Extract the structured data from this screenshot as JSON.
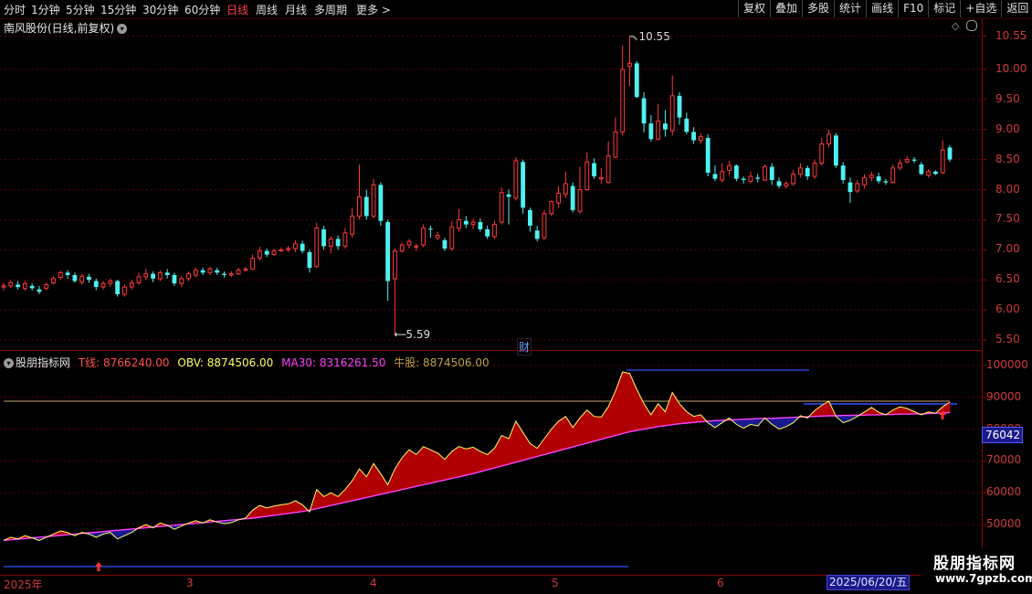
{
  "toolbar": {
    "periods": [
      "分时",
      "1分钟",
      "5分钟",
      "15分钟",
      "30分钟",
      "60分钟",
      "日线",
      "周线",
      "月线",
      "多周期",
      "更多 >"
    ],
    "active_period": "日线",
    "actions": [
      "复权",
      "叠加",
      "多股",
      "统计",
      "画线",
      "F10",
      "标记",
      "+自选",
      "返回"
    ]
  },
  "chart_title": "南风股份(日线,前复权)",
  "price_axis": [
    "10.55",
    "10.00",
    "9.50",
    "9.00",
    "8.50",
    "8.00",
    "7.50",
    "7.00",
    "6.50",
    "6.00",
    "5.50"
  ],
  "annotations": {
    "high": "10.55",
    "low": "5.59",
    "finance_marker": "财"
  },
  "indicator": {
    "name": "股朋指标网",
    "t_line": "T线: 8766240.00",
    "obv": "OBV: 8874506.00",
    "ma30": "MA30: 8316261.50",
    "niu": "牛股: 8874506.00",
    "axis": [
      "100000",
      "90000",
      "80000",
      "70000",
      "60000",
      "50000"
    ],
    "current_value": "76042"
  },
  "dates": {
    "labels": [
      "2025年",
      "3",
      "4",
      "5",
      "6"
    ],
    "selected": "2025/06/20/五"
  },
  "watermark": {
    "title": "股朋指标网",
    "url": "www.7gpzb.com"
  },
  "colors": {
    "up": "#ff3a3a",
    "down": "#4ff0f0",
    "obv_fill": "#b00000",
    "obv_line": "#ffff60",
    "ma30": "#ff40ff",
    "hline": "#3050ff"
  },
  "chart_data": {
    "type": "candlestick",
    "title": "南风股份(日线,前复权)",
    "ylim": [
      5.45,
      10.7
    ],
    "candles": [
      [
        6.38,
        6.4,
        6.45,
        6.32
      ],
      [
        6.4,
        6.45,
        6.5,
        6.36
      ],
      [
        6.42,
        6.38,
        6.48,
        6.34
      ],
      [
        6.36,
        6.44,
        6.48,
        6.32
      ],
      [
        6.4,
        6.36,
        6.44,
        6.32
      ],
      [
        6.34,
        6.3,
        6.4,
        6.26
      ],
      [
        6.36,
        6.42,
        6.46,
        6.32
      ],
      [
        6.45,
        6.52,
        6.56,
        6.42
      ],
      [
        6.54,
        6.62,
        6.65,
        6.5
      ],
      [
        6.62,
        6.58,
        6.66,
        6.52
      ],
      [
        6.58,
        6.48,
        6.62,
        6.45
      ],
      [
        6.46,
        6.56,
        6.6,
        6.42
      ],
      [
        6.55,
        6.5,
        6.6,
        6.45
      ],
      [
        6.48,
        6.38,
        6.52,
        6.33
      ],
      [
        6.38,
        6.44,
        6.48,
        6.34
      ],
      [
        6.44,
        6.48,
        6.52,
        6.38
      ],
      [
        6.48,
        6.26,
        6.5,
        6.22
      ],
      [
        6.26,
        6.38,
        6.42,
        6.22
      ],
      [
        6.38,
        6.45,
        6.5,
        6.34
      ],
      [
        6.45,
        6.55,
        6.62,
        6.42
      ],
      [
        6.55,
        6.6,
        6.68,
        6.5
      ],
      [
        6.6,
        6.52,
        6.64,
        6.46
      ],
      [
        6.52,
        6.62,
        6.66,
        6.48
      ],
      [
        6.62,
        6.58,
        6.68,
        6.52
      ],
      [
        6.58,
        6.44,
        6.62,
        6.4
      ],
      [
        6.44,
        6.52,
        6.56,
        6.38
      ],
      [
        6.52,
        6.6,
        6.64,
        6.48
      ],
      [
        6.58,
        6.66,
        6.7,
        6.54
      ],
      [
        6.66,
        6.62,
        6.7,
        6.58
      ],
      [
        6.62,
        6.68,
        6.72,
        6.58
      ],
      [
        6.66,
        6.62,
        6.7,
        6.58
      ],
      [
        6.6,
        6.58,
        6.64,
        6.54
      ],
      [
        6.58,
        6.6,
        6.64,
        6.55
      ],
      [
        6.6,
        6.66,
        6.7,
        6.58
      ],
      [
        6.66,
        6.68,
        6.72,
        6.64
      ],
      [
        6.68,
        6.86,
        6.92,
        6.66
      ],
      [
        6.86,
        6.98,
        7.05,
        6.82
      ],
      [
        6.98,
        6.92,
        7.02,
        6.88
      ],
      [
        6.92,
        6.98,
        7.02,
        6.9
      ],
      [
        6.98,
        7.0,
        7.04,
        6.96
      ],
      [
        7.0,
        7.02,
        7.06,
        6.96
      ],
      [
        7.02,
        7.1,
        7.16,
        6.96
      ],
      [
        7.1,
        6.98,
        7.15,
        6.94
      ],
      [
        6.96,
        6.7,
        7.0,
        6.62
      ],
      [
        6.72,
        7.36,
        7.45,
        6.7
      ],
      [
        7.34,
        7.06,
        7.4,
        7.0
      ],
      [
        7.06,
        7.18,
        7.22,
        6.94
      ],
      [
        7.18,
        7.06,
        7.24,
        7.0
      ],
      [
        7.06,
        7.28,
        7.36,
        7.02
      ],
      [
        7.26,
        7.56,
        7.7,
        7.2
      ],
      [
        7.56,
        7.88,
        8.42,
        7.5
      ],
      [
        7.88,
        7.56,
        8.0,
        7.5
      ],
      [
        7.56,
        8.08,
        8.18,
        7.52
      ],
      [
        8.08,
        7.48,
        8.12,
        7.4
      ],
      [
        7.46,
        6.48,
        7.5,
        6.15
      ],
      [
        6.52,
        6.98,
        7.02,
        5.59
      ],
      [
        6.98,
        7.08,
        7.12,
        6.95
      ],
      [
        7.08,
        7.14,
        7.18,
        7.02
      ],
      [
        7.05,
        7.06,
        7.1,
        6.98
      ],
      [
        7.08,
        7.36,
        7.42,
        7.04
      ],
      [
        7.35,
        7.34,
        7.4,
        7.2
      ],
      [
        7.2,
        7.24,
        7.3,
        7.16
      ],
      [
        7.16,
        7.02,
        7.2,
        6.98
      ],
      [
        7.02,
        7.38,
        7.48,
        6.98
      ],
      [
        7.36,
        7.5,
        7.68,
        7.3
      ],
      [
        7.48,
        7.42,
        7.56,
        7.36
      ],
      [
        7.42,
        7.46,
        7.52,
        7.34
      ],
      [
        7.46,
        7.34,
        7.52,
        7.3
      ],
      [
        7.34,
        7.22,
        7.4,
        7.18
      ],
      [
        7.22,
        7.42,
        7.48,
        7.18
      ],
      [
        7.46,
        7.95,
        8.04,
        7.42
      ],
      [
        7.92,
        7.88,
        8.0,
        7.42
      ],
      [
        7.86,
        8.48,
        8.54,
        7.82
      ],
      [
        8.46,
        7.7,
        8.5,
        7.6
      ],
      [
        7.66,
        7.4,
        7.7,
        7.3
      ],
      [
        7.32,
        7.18,
        7.4,
        7.14
      ],
      [
        7.2,
        7.6,
        7.66,
        7.16
      ],
      [
        7.6,
        7.8,
        7.82,
        7.56
      ],
      [
        7.78,
        7.94,
        8.06,
        7.7
      ],
      [
        7.92,
        8.1,
        8.3,
        7.86
      ],
      [
        8.06,
        7.66,
        8.12,
        7.62
      ],
      [
        7.64,
        8.0,
        8.38,
        7.6
      ],
      [
        8.0,
        8.46,
        8.62,
        7.98
      ],
      [
        8.44,
        8.22,
        8.52,
        8.18
      ],
      [
        8.18,
        8.2,
        8.36,
        8.1
      ],
      [
        8.12,
        8.56,
        8.8,
        8.1
      ],
      [
        8.54,
        8.96,
        9.2,
        8.52
      ],
      [
        8.96,
        10.0,
        10.4,
        8.9
      ],
      [
        10.05,
        10.1,
        10.55,
        9.72
      ],
      [
        10.1,
        9.54,
        10.14,
        9.52
      ],
      [
        9.52,
        9.1,
        9.62,
        8.95
      ],
      [
        9.1,
        8.84,
        9.24,
        8.8
      ],
      [
        8.84,
        9.14,
        9.42,
        8.82
      ],
      [
        9.1,
        9.0,
        9.32,
        8.88
      ],
      [
        8.98,
        9.56,
        9.9,
        8.9
      ],
      [
        9.56,
        9.2,
        9.62,
        9.08
      ],
      [
        9.18,
        8.96,
        9.28,
        8.92
      ],
      [
        8.96,
        8.82,
        9.04,
        8.76
      ],
      [
        8.82,
        8.88,
        8.94,
        8.76
      ],
      [
        8.86,
        8.28,
        8.92,
        8.22
      ],
      [
        8.26,
        8.18,
        8.4,
        8.14
      ],
      [
        8.16,
        8.3,
        8.44,
        8.12
      ],
      [
        8.32,
        8.4,
        8.48,
        8.24
      ],
      [
        8.4,
        8.18,
        8.42,
        8.14
      ],
      [
        8.18,
        8.16,
        8.22,
        8.1
      ],
      [
        8.14,
        8.22,
        8.3,
        8.1
      ],
      [
        8.2,
        8.18,
        8.26,
        8.12
      ],
      [
        8.16,
        8.38,
        8.42,
        8.14
      ],
      [
        8.38,
        8.16,
        8.44,
        8.08
      ],
      [
        8.14,
        8.06,
        8.2,
        8.02
      ],
      [
        8.06,
        8.1,
        8.14,
        8.02
      ],
      [
        8.1,
        8.26,
        8.32,
        8.06
      ],
      [
        8.26,
        8.36,
        8.44,
        8.2
      ],
      [
        8.36,
        8.22,
        8.4,
        8.16
      ],
      [
        8.22,
        8.44,
        8.5,
        8.18
      ],
      [
        8.44,
        8.76,
        8.86,
        8.4
      ],
      [
        8.76,
        8.92,
        9.0,
        8.7
      ],
      [
        8.9,
        8.4,
        8.94,
        8.36
      ],
      [
        8.4,
        8.16,
        8.46,
        8.1
      ],
      [
        8.12,
        7.96,
        8.2,
        7.78
      ],
      [
        7.98,
        8.1,
        8.16,
        7.94
      ],
      [
        8.08,
        8.2,
        8.26,
        8.02
      ],
      [
        8.2,
        8.24,
        8.3,
        8.14
      ],
      [
        8.22,
        8.14,
        8.28,
        8.1
      ],
      [
        8.14,
        8.12,
        8.18,
        8.08
      ],
      [
        8.12,
        8.36,
        8.42,
        8.1
      ],
      [
        8.36,
        8.44,
        8.5,
        8.32
      ],
      [
        8.46,
        8.5,
        8.56,
        8.44
      ],
      [
        8.5,
        8.48,
        8.54,
        8.44
      ],
      [
        8.42,
        8.26,
        8.46,
        8.24
      ],
      [
        8.24,
        8.3,
        8.34,
        8.2
      ],
      [
        8.3,
        8.26,
        8.32,
        8.24
      ],
      [
        8.28,
        8.66,
        8.82,
        8.26
      ],
      [
        8.7,
        8.5,
        8.74,
        8.46
      ]
    ],
    "obv": [
      45,
      46,
      45.5,
      46.5,
      45.8,
      45,
      46,
      47,
      48,
      47.5,
      46.5,
      47.5,
      47,
      46,
      47,
      47.5,
      45.5,
      46.5,
      47.5,
      49,
      50,
      49,
      50.5,
      49.8,
      48.5,
      49.5,
      50.5,
      51.2,
      50.5,
      51.5,
      50.8,
      50.3,
      50.6,
      51.5,
      52,
      54.5,
      56,
      55.2,
      55.8,
      56.2,
      56.5,
      57.5,
      56.2,
      54,
      61,
      58.8,
      60,
      58.8,
      61,
      63.8,
      67.5,
      65,
      69.2,
      66,
      62.5,
      67.5,
      71,
      73.5,
      72,
      74.5,
      73.5,
      72.5,
      70.5,
      73,
      74.5,
      73.8,
      74.3,
      73,
      72,
      74,
      78,
      77,
      82.5,
      79,
      75.5,
      74,
      77,
      80,
      82.5,
      84,
      80.5,
      83.5,
      86,
      84,
      83.8,
      87,
      92,
      98,
      97.5,
      92.5,
      88,
      84.5,
      88,
      85.5,
      91.5,
      88,
      85.5,
      84,
      84.5,
      82,
      80.5,
      82,
      83.5,
      81.5,
      80.3,
      81.5,
      81,
      83.5,
      81.5,
      80,
      80.8,
      82,
      84.2,
      83.5,
      85.8,
      87.5,
      88.8,
      84,
      82,
      82.8,
      84,
      85.4,
      86.8,
      85.3,
      84.5,
      86,
      87,
      86.5,
      85.5,
      84.5,
      85.4,
      85,
      87,
      88.5
    ],
    "ma30": [
      45,
      45.2,
      45.4,
      45.6,
      45.8,
      46,
      46.2,
      46.4,
      46.6,
      46.8,
      47,
      47.2,
      47.4,
      47.6,
      47.8,
      48,
      48.2,
      48.4,
      48.6,
      48.8,
      49,
      49.2,
      49.4,
      49.6,
      49.8,
      50,
      50.2,
      50.4,
      50.6,
      50.8,
      51,
      51.2,
      51.4,
      51.6,
      51.8,
      52,
      52.3,
      52.6,
      52.9,
      53.2,
      53.5,
      53.8,
      54.1,
      54.5,
      55,
      55.5,
      56,
      56.5,
      57,
      57.5,
      58,
      58.5,
      59,
      59.5,
      60,
      60.5,
      61,
      61.5,
      62,
      62.5,
      63,
      63.5,
      64,
      64.5,
      65,
      65.5,
      66,
      66.6,
      67.2,
      67.8,
      68.4,
      69,
      69.6,
      70.2,
      70.8,
      71.4,
      72,
      72.6,
      73.2,
      73.8,
      74.4,
      75,
      75.6,
      76.2,
      76.8,
      77.4,
      78,
      78.6,
      79.2,
      79.6,
      80,
      80.4,
      80.8,
      81.1,
      81.4,
      81.7,
      81.9,
      82.1,
      82.3,
      82.5,
      82.7,
      82.8,
      82.9,
      83,
      83.1,
      83.2,
      83.3,
      83.4,
      83.4,
      83.5,
      83.6,
      83.7,
      83.8,
      83.9,
      84,
      84.1,
      84.2,
      84.2,
      84.3,
      84.3,
      84.4,
      84.4,
      84.5,
      84.5,
      84.6,
      84.6,
      84.7,
      84.7,
      84.8,
      84.8,
      84.9,
      85,
      85.1,
      85.2
    ]
  }
}
